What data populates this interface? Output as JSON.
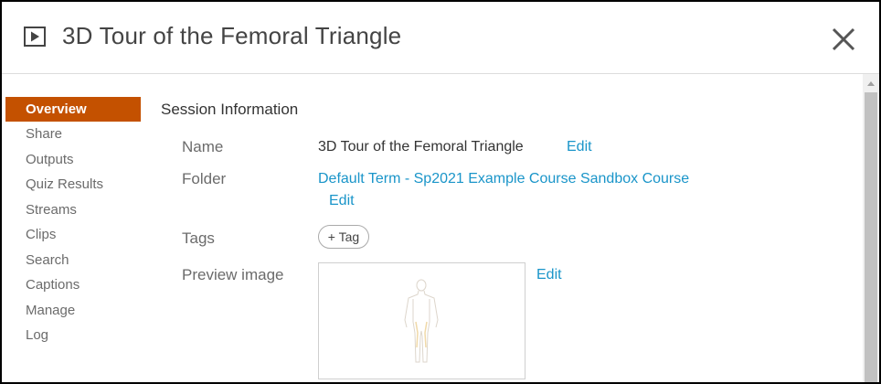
{
  "header": {
    "title": "3D Tour of the Femoral Triangle",
    "icon": "play-icon",
    "close_icon": "close-icon"
  },
  "sidebar": {
    "items": [
      {
        "label": "Overview",
        "active": true
      },
      {
        "label": "Share"
      },
      {
        "label": "Outputs"
      },
      {
        "label": "Quiz Results"
      },
      {
        "label": "Streams"
      },
      {
        "label": "Clips"
      },
      {
        "label": "Search"
      },
      {
        "label": "Captions"
      },
      {
        "label": "Manage"
      },
      {
        "label": "Log"
      }
    ],
    "active_color": "#c45100"
  },
  "session": {
    "section_title": "Session Information",
    "name_label": "Name",
    "name_value": "3D Tour of the Femoral Triangle",
    "name_edit": "Edit",
    "folder_label": "Folder",
    "folder_value": "Default Term - Sp2021 Example Course Sandbox Course",
    "folder_edit": "Edit",
    "tags_label": "Tags",
    "tag_button": "+ Tag",
    "preview_label": "Preview image",
    "preview_edit": "Edit"
  },
  "colors": {
    "link": "#1a95c9",
    "accent": "#c45100"
  }
}
